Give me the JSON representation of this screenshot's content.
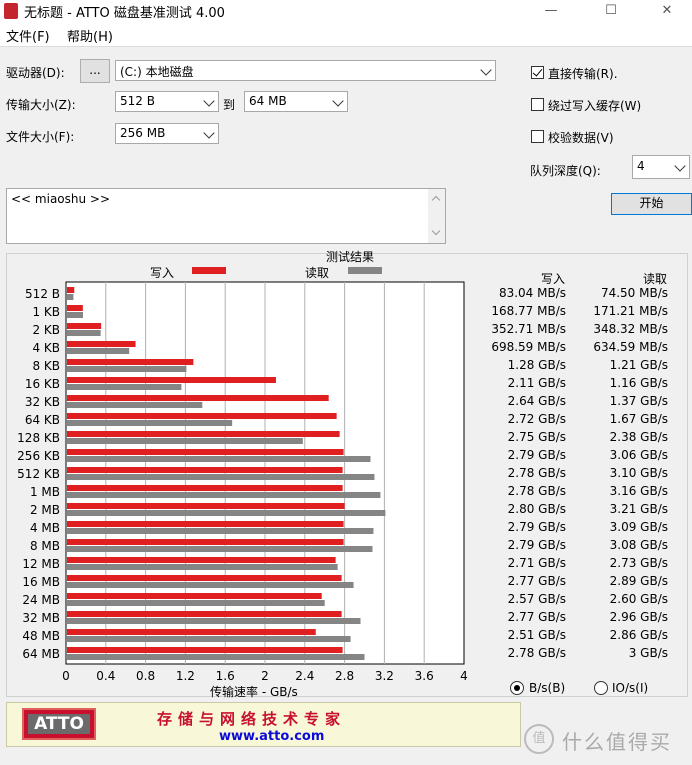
{
  "window": {
    "title": "无标题 - ATTO 磁盘基准测试 4.00",
    "minimize": "—",
    "maximize": "☐",
    "close": "✕"
  },
  "menu": {
    "file": "文件(F)",
    "help": "帮助(H)"
  },
  "settings": {
    "drive_label": "驱动器(D):",
    "browse_label": "...",
    "drive_value": "(C:) 本地磁盘",
    "transfer_size_label": "传输大小(Z):",
    "transfer_from": "512 B",
    "to_label": "到",
    "transfer_to": "64 MB",
    "file_size_label": "文件大小(F):",
    "file_size": "256 MB",
    "direct_io_label": "直接传输(R).",
    "direct_io_checked": true,
    "bypass_cache_label": "绕过写入缓存(W)",
    "bypass_cache_checked": false,
    "verify_label": "校验数据(V)",
    "verify_checked": false,
    "queue_depth_label": "队列深度(Q):",
    "queue_depth": "4",
    "start_label": "开始",
    "description": "<< miaoshu >>"
  },
  "results": {
    "title": "测试结果",
    "legend_write": "写入",
    "legend_read": "读取",
    "col_write": "写入",
    "col_read": "读取",
    "write_values": [
      "83.04 MB/s",
      "168.77 MB/s",
      "352.71 MB/s",
      "698.59 MB/s",
      "1.28 GB/s",
      "2.11 GB/s",
      "2.64 GB/s",
      "2.72 GB/s",
      "2.75 GB/s",
      "2.79 GB/s",
      "2.78 GB/s",
      "2.78 GB/s",
      "2.80 GB/s",
      "2.79 GB/s",
      "2.79 GB/s",
      "2.71 GB/s",
      "2.77 GB/s",
      "2.57 GB/s",
      "2.77 GB/s",
      "2.51 GB/s",
      "2.78 GB/s"
    ],
    "read_values": [
      "74.50 MB/s",
      "171.21 MB/s",
      "348.32 MB/s",
      "634.59 MB/s",
      "1.21 GB/s",
      "1.16 GB/s",
      "1.37 GB/s",
      "1.67 GB/s",
      "2.38 GB/s",
      "3.06 GB/s",
      "3.10 GB/s",
      "3.16 GB/s",
      "3.21 GB/s",
      "3.09 GB/s",
      "3.08 GB/s",
      "2.73 GB/s",
      "2.89 GB/s",
      "2.60 GB/s",
      "2.96 GB/s",
      "2.86 GB/s",
      "3 GB/s"
    ],
    "unit_bytes_label": "B/s(B)",
    "unit_bytes_selected": true,
    "unit_io_label": "IO/s(I)",
    "unit_io_selected": false
  },
  "colors": {
    "write": "#e02020",
    "read": "#858585",
    "footer_text": "#c8102e",
    "link": "#0b0bd8"
  },
  "chart_data": {
    "type": "bar",
    "orientation": "horizontal",
    "categories": [
      "512 B",
      "1 KB",
      "2 KB",
      "4 KB",
      "8 KB",
      "16 KB",
      "32 KB",
      "64 KB",
      "128 KB",
      "256 KB",
      "512 KB",
      "1 MB",
      "2 MB",
      "4 MB",
      "8 MB",
      "12 MB",
      "16 MB",
      "24 MB",
      "32 MB",
      "48 MB",
      "64 MB"
    ],
    "series": [
      {
        "name": "写入",
        "values": [
          0.083,
          0.169,
          0.353,
          0.699,
          1.28,
          2.11,
          2.64,
          2.72,
          2.75,
          2.79,
          2.78,
          2.78,
          2.8,
          2.79,
          2.79,
          2.71,
          2.77,
          2.57,
          2.77,
          2.51,
          2.78
        ]
      },
      {
        "name": "读取",
        "values": [
          0.0745,
          0.171,
          0.348,
          0.635,
          1.21,
          1.16,
          1.37,
          1.67,
          2.38,
          3.06,
          3.1,
          3.16,
          3.21,
          3.09,
          3.08,
          2.73,
          2.89,
          2.6,
          2.96,
          2.86,
          3.0
        ]
      }
    ],
    "xlabel": "传输速率 - GB/s",
    "xticks": [
      "0",
      "0.4",
      "0.8",
      "1.2",
      "1.6",
      "2",
      "2.4",
      "2.8",
      "3.2",
      "3.6",
      "4"
    ],
    "xlim": [
      0,
      4
    ],
    "grid": true,
    "legend": "top"
  },
  "footer": {
    "logo": "ATTO",
    "tagline": "存储与网络技术专家",
    "url": "www.atto.com"
  },
  "watermark": "什么值得买"
}
